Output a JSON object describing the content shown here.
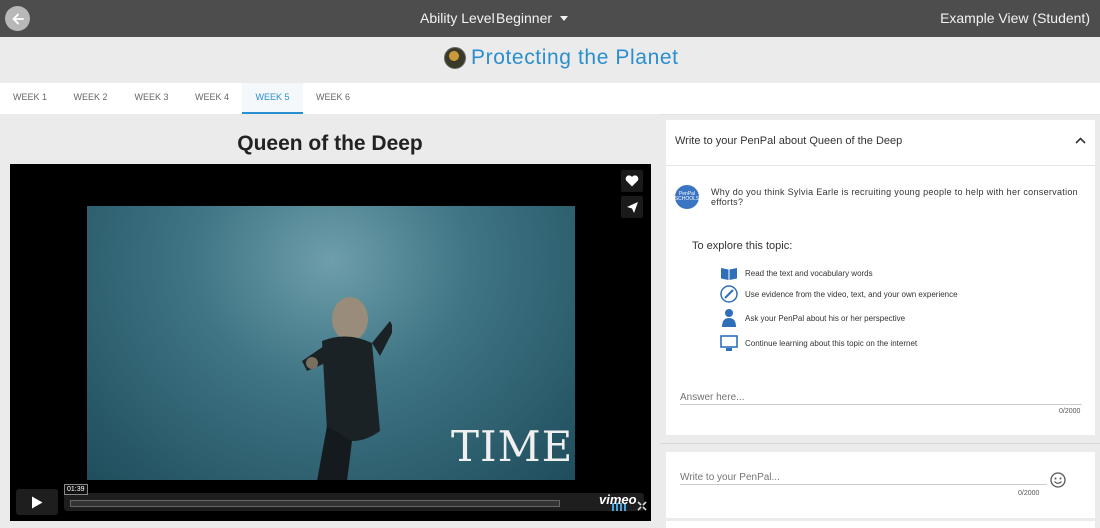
{
  "header": {
    "ability_label": "Ability Level",
    "ability_value": "Beginner",
    "view_label": "Example View (Student)"
  },
  "page": {
    "title": "Protecting the Planet"
  },
  "tabs": [
    {
      "label": "WEEK 1",
      "active": false
    },
    {
      "label": "WEEK 2",
      "active": false
    },
    {
      "label": "WEEK 3",
      "active": false
    },
    {
      "label": "WEEK 4",
      "active": false
    },
    {
      "label": "WEEK 5",
      "active": true
    },
    {
      "label": "WEEK 6",
      "active": false
    }
  ],
  "lesson": {
    "title": "Queen of the Deep"
  },
  "video": {
    "brand_overlay": "TIME",
    "timecode": "01:39",
    "player_brand": "vimeo"
  },
  "prompt_panel": {
    "heading": "Write to your PenPal about Queen of the Deep",
    "icon_text": "PenPal SCHOOLS",
    "question": "Why do you think Sylvia Earle is recruiting young people to help with her conservation efforts?",
    "explore_label": "To explore this topic:",
    "tips": [
      {
        "icon": "book-icon",
        "text": "Read the text and vocabulary words"
      },
      {
        "icon": "pencil-icon",
        "text": "Use evidence from the video, text, and your own experience"
      },
      {
        "icon": "people-icon",
        "text": "Ask your PenPal about his or her perspective"
      },
      {
        "icon": "computer-icon",
        "text": "Continue learning about this topic on the internet"
      }
    ],
    "answer_placeholder": "Answer here...",
    "answer_counter": "0/2000"
  },
  "penpal_panel": {
    "placeholder": "Write to your PenPal...",
    "counter": "0/2000"
  },
  "colors": {
    "accent": "#2a8fcf",
    "topbar": "#4d4d4d"
  }
}
